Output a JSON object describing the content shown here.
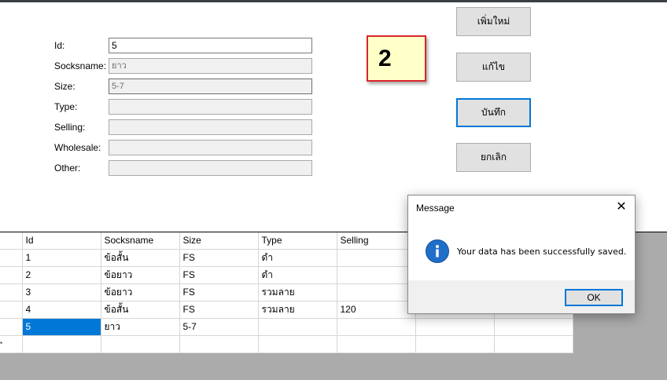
{
  "form": {
    "fields": [
      {
        "label": "Id:",
        "value": "5"
      },
      {
        "label": "Socksname:",
        "value": "ยาว"
      },
      {
        "label": "Size:",
        "value": "5-7"
      },
      {
        "label": "Type:",
        "value": ""
      },
      {
        "label": "Selling:",
        "value": ""
      },
      {
        "label": "Wholesale:",
        "value": ""
      },
      {
        "label": "Other:",
        "value": ""
      }
    ]
  },
  "counter": {
    "value": "2"
  },
  "buttons": {
    "add": "เพิ่มใหม่",
    "edit": "แก้ไข",
    "save": "บันทึก",
    "cancel": "ยกเลิก"
  },
  "grid": {
    "columns": [
      "Id",
      "Socksname",
      "Size",
      "Type",
      "Selling",
      "",
      ""
    ],
    "rows": [
      [
        "1",
        "ข้อสั้น",
        "FS",
        "ดำ",
        "",
        "",
        ""
      ],
      [
        "2",
        "ข้อยาว",
        "FS",
        "ดำ",
        "",
        "",
        ""
      ],
      [
        "3",
        "ข้อยาว",
        "FS",
        "รวมลาย",
        "",
        "",
        ""
      ],
      [
        "4",
        "ข้อสั้น",
        "FS",
        "รวมลาย",
        "120",
        "",
        ""
      ],
      [
        "5",
        "ยาว",
        "5-7",
        "",
        "",
        "",
        ""
      ]
    ],
    "new_row_marker": "*"
  },
  "dialog": {
    "title": "Message",
    "close_glyph": "✕",
    "message": "Your data has been successfully saved.",
    "ok_label": "OK",
    "icon_glyph": "i"
  },
  "colors": {
    "accent": "#0078d7",
    "counter_border": "#d9262a",
    "counter_bg": "#ffffc8",
    "info_icon": "#1f6fc9"
  }
}
